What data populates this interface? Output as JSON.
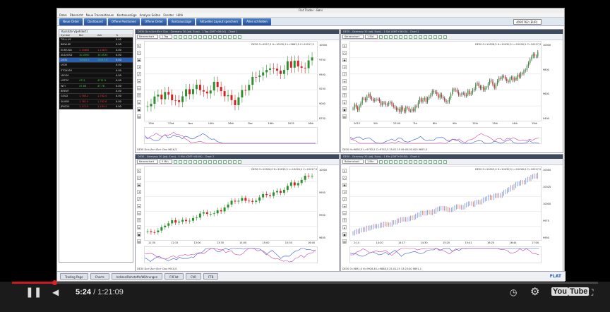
{
  "app": {
    "title": "Flat Trader - Børs",
    "menu": [
      "Datei",
      "Übersicht",
      "Neue Transaktionen",
      "Kontoauszüge",
      "Analyse Seiten",
      "Fenster",
      "Hilfe"
    ],
    "toolbar_buttons": [
      "Neue Order",
      "Dashboard",
      "Offene Positionen",
      "Offene Order",
      "Kontoauszüge",
      "Aktuelles Layout speichern",
      "Alles schließen"
    ],
    "account": "4095762 (EUR)"
  },
  "watchlist": {
    "title": "Kurslste Vgehliert)",
    "columns": [
      "Symbol",
      "Bid",
      "Ask",
      "%"
    ],
    "rows": [
      {
        "name": "TSLA.US",
        "bid": "",
        "ask": "",
        "pct": "0.00",
        "dir": "up"
      },
      {
        "name": "BMW.DE",
        "bid": "",
        "ask": "",
        "pct": "0.00",
        "dir": "up"
      },
      {
        "name": "EUR/USD",
        "bid": "1.10862",
        "ask": "1.10872",
        "pct": "0.00",
        "dir": "dn"
      },
      {
        "name": "AUD/USD",
        "bid": "10.0500",
        "ask": "10.0530",
        "pct": "0.00",
        "dir": "up"
      },
      {
        "name": "DE30",
        "bid": "10016.5",
        "ask": "10017.8",
        "pct": "0.00",
        "dir": "up"
      },
      {
        "name": "US30",
        "bid": "",
        "ask": "",
        "pct": "0.00",
        "dir": "dn"
      },
      {
        "name": "STOXX50",
        "bid": "",
        "ask": "",
        "pct": "0.00",
        "dir": "dn"
      },
      {
        "name": "UK100",
        "bid": "",
        "ask": "",
        "pct": "0.00",
        "dir": "up"
      },
      {
        "name": "USTEC",
        "bid": "4711",
        "ask": "4711.5",
        "pct": "0.00",
        "dir": "up"
      },
      {
        "name": "WTI",
        "bid": "47.68",
        "ask": "47.78",
        "pct": "0.00",
        "dir": "up"
      },
      {
        "name": "BRENT",
        "bid": "",
        "ask": "",
        "pct": "0.00",
        "dir": "dn"
      },
      {
        "name": "GOLD",
        "bid": "1,780.2",
        "ask": "1,782.0",
        "pct": "0.00",
        "dir": "dn"
      },
      {
        "name": "SILVER",
        "bid": "1,781.4",
        "ask": "1,782.6",
        "pct": "0.00",
        "dir": "dn"
      },
      {
        "name": "JPN225",
        "bid": "1,172.5",
        "ask": "1,163.4",
        "pct": "0.00",
        "dir": "dn"
      }
    ]
  },
  "charts": [
    {
      "window": "DE30 Dx+/Ax+/Ex+ Dxx - Germany 30 (adj. Euro) - 1 Tag (GMT+06:00) - Chart 1",
      "type": "Kerzenchart",
      "period": "1 Tag",
      "info": "DE30 O=9927,5 H=10030,5 L=9863,5 C=10017,5",
      "footer": "DE30 Dx+/Ax+/Ex+ Dxx 9616,5",
      "xlabels": [
        "13th",
        "23rd",
        "Nov",
        "14th",
        "26th",
        "Dec",
        "16th",
        "2015",
        "16th"
      ],
      "yticks": [
        "10000",
        "9750",
        "9500",
        "9250",
        "9000",
        "8750"
      ]
    },
    {
      "window": "DE30 - Germany 30 (adj. Euro) - 1 Std (GMT+06:00) - Chart 2",
      "type": "Kerzenchart",
      "period": "1 Std",
      "info": "DE30 O=10028,5 H=10030,5 L=10026,5 C=10017,5",
      "footer": "DE30 H=9892,5 L=9792,5 C=9742,5 25.01.15 09:00:00.000 9655,5",
      "xlabels": [
        "2015",
        "5th",
        "23:00",
        "7th",
        "8th",
        "9th",
        "12th",
        "13th",
        "14th",
        "15th"
      ],
      "yticks": [
        "10000",
        "9800",
        "9600",
        "9400"
      ]
    },
    {
      "window": "DE30 - Germany 30 (adj. Euro) - 5 Min (GMT+06:00) - Chart 3",
      "type": "Kerzenchart",
      "period": "5 Min",
      "info": "DE30 O=10026,0 H=10030,5 L=10026,0 C=10017,5",
      "footer": "DE30 Dx+/Ax+/Ex+ Dxx 9910,0",
      "xlabels": [
        "11:30",
        "12:15",
        "13:00",
        "13:30",
        "14:00",
        "15:00",
        "15:30",
        "16:00"
      ],
      "yticks": [
        "10000",
        "9950",
        "9900",
        "9850"
      ]
    },
    {
      "window": "DE30 - Germany 30 (adj. Euro) - 1 Min (GMT+06:00) - Chart 4",
      "type": "Balkenchart",
      "period": "1 Min",
      "info": "DE30 O=10022,0 H=10030,5 L=10026,0 C=10017,5",
      "footer": "DE30 0=9891,0 H=9926,8 L=9888,0 25.01.15 13:23:00 9891,1",
      "xlabels": [
        "2:14",
        "14:20",
        "14:17",
        "14:30",
        "15:20",
        "15:41",
        "16:20",
        "16:44",
        "17:00"
      ],
      "yticks": [
        "10050",
        "10025",
        "10000",
        "9975",
        "9950"
      ]
    }
  ],
  "taskbar": [
    "Trading Page",
    "Charts",
    "Indizes/Rohstoffe/Währungen",
    "FXFlat",
    "CVR",
    "FTB"
  ],
  "logo": "FLAT",
  "player": {
    "current": "5:24",
    "total": "/ 1:21:09",
    "progress_pct": 6.7,
    "brand": "You",
    "brand2": "Tube"
  },
  "colors": {
    "up": "#2f8f2f",
    "down": "#d22020",
    "bar_up": "#4a6ad8",
    "bar_dn": "#d84a4a",
    "accent": "#cc181e"
  }
}
